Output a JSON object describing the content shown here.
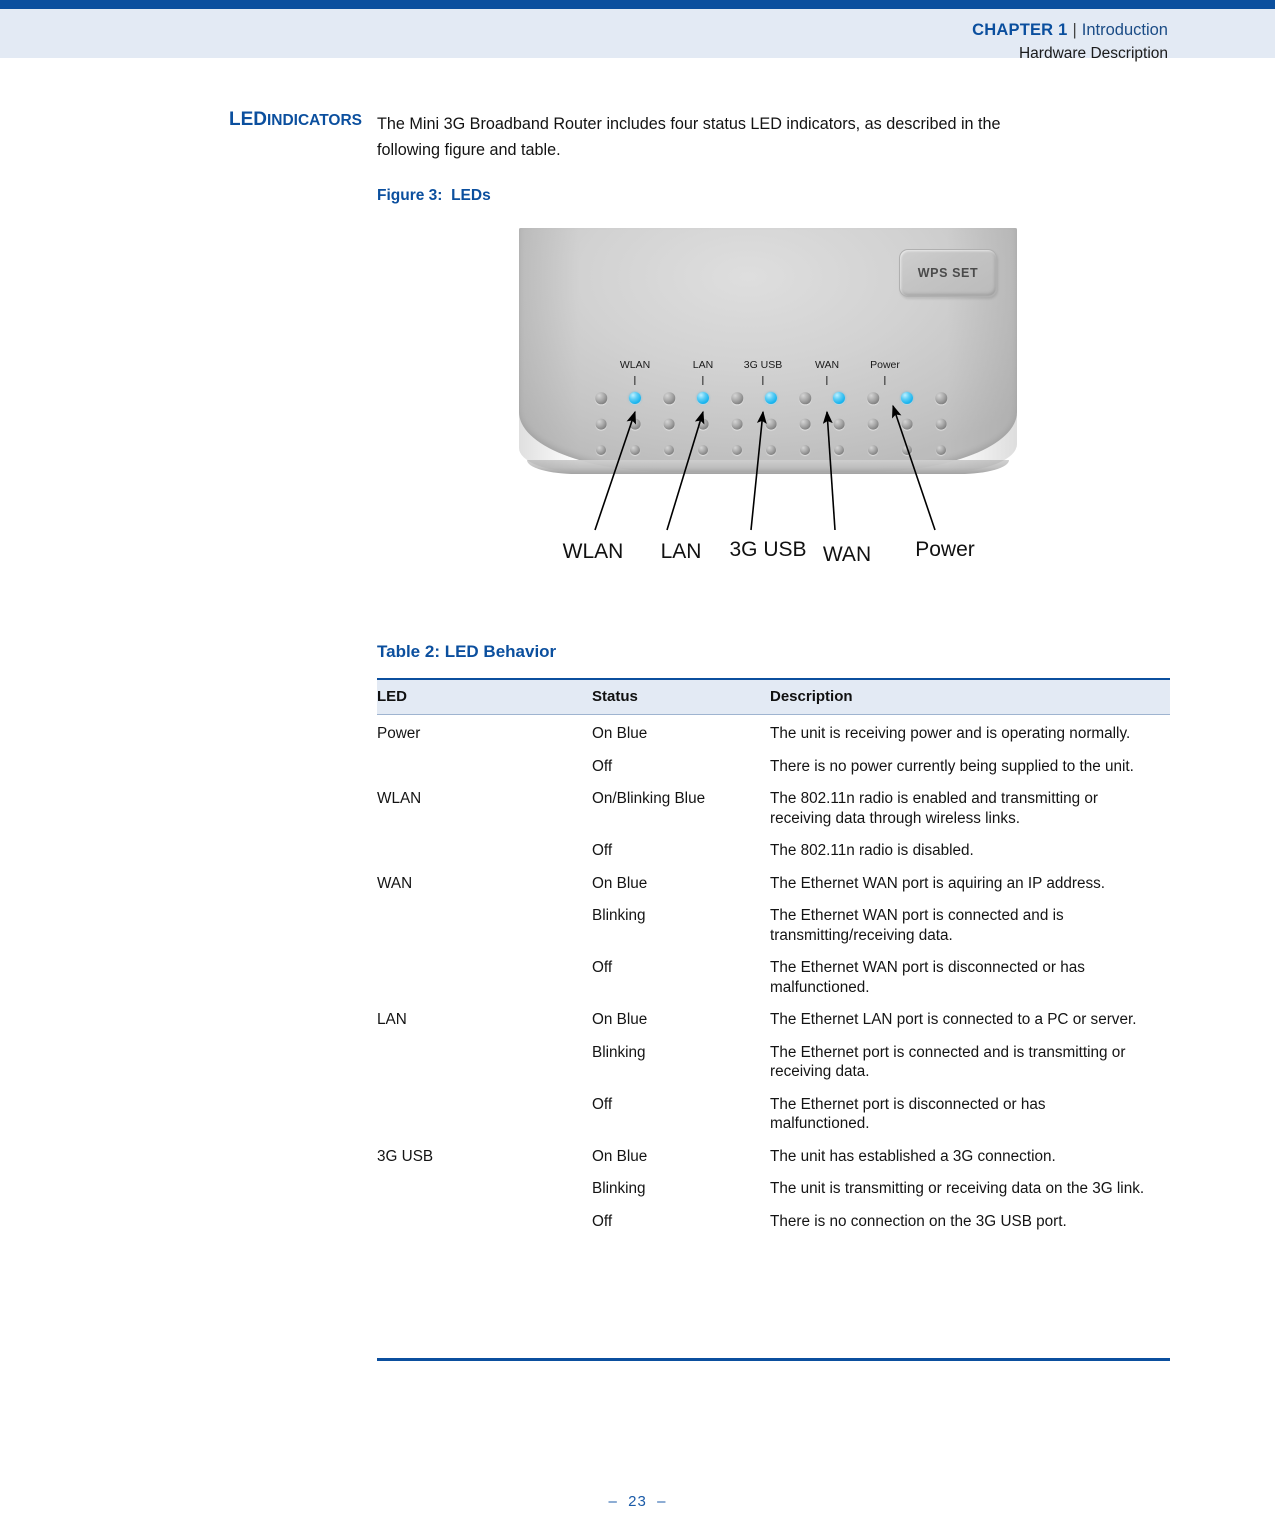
{
  "header": {
    "chapter_label": "CHAPTER 1",
    "separator": "|",
    "section": "Introduction",
    "subsection": "Hardware Description"
  },
  "side_heading": {
    "main": "LED",
    "rest": "INDICATORS"
  },
  "body": {
    "paragraph": "The Mini 3G Broadband Router includes four status LED indicators, as described in the following figure and table."
  },
  "figure": {
    "caption": "Figure 3:  LEDs",
    "wps_button_label": "WPS SET",
    "device_led_labels": [
      "WLAN",
      "LAN",
      "3G USB",
      "WAN",
      "Power"
    ],
    "callout_labels": [
      "WLAN",
      "LAN",
      "3G USB",
      "WAN",
      "Power"
    ],
    "led_colors": {
      "on_blue": "#19b4ee",
      "off_gray": "#a9a9a9"
    }
  },
  "table": {
    "caption": "Table 2: LED Behavior",
    "columns": [
      "LED",
      "Status",
      "Description"
    ],
    "rows": [
      {
        "led": "Power",
        "status": "On Blue",
        "description": "The unit is receiving power and is operating normally."
      },
      {
        "led": "",
        "status": "Off",
        "description": "There is no power currently being supplied to the unit."
      },
      {
        "led": "WLAN",
        "status": "On/Blinking Blue",
        "description": "The 802.11n radio is enabled and transmitting or receiving data through wireless links."
      },
      {
        "led": "",
        "status": "Off",
        "description": "The 802.11n radio is disabled."
      },
      {
        "led": "WAN",
        "status": "On Blue",
        "description": "The Ethernet WAN port is aquiring an IP address."
      },
      {
        "led": "",
        "status": "Blinking",
        "description": "The Ethernet WAN port is connected and is transmitting/receiving data."
      },
      {
        "led": "",
        "status": "Off",
        "description": "The Ethernet WAN port is disconnected or has malfunctioned."
      },
      {
        "led": "LAN",
        "status": "On Blue",
        "description": "The Ethernet LAN port is connected to a PC or server."
      },
      {
        "led": "",
        "status": "Blinking",
        "description": "The Ethernet port is connected and is transmitting or receiving data."
      },
      {
        "led": "",
        "status": "Off",
        "description": "The Ethernet port is disconnected or has malfunctioned."
      },
      {
        "led": "3G USB",
        "status": "On Blue",
        "description": "The unit has established a 3G connection."
      },
      {
        "led": "",
        "status": "Blinking",
        "description": "The unit is transmitting or receiving data on the 3G link."
      },
      {
        "led": "",
        "status": "Off",
        "description": "There is no connection on the 3G USB port."
      }
    ]
  },
  "footer": {
    "page_number": "–  23  –"
  },
  "colors": {
    "accent_blue": "#0B4F9E",
    "band_blue": "#E3EAF4",
    "page_number_blue": "#1B5BA8"
  }
}
